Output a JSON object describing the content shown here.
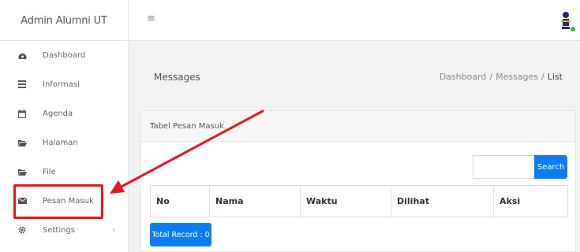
{
  "topbar": {
    "brand": "Admin Alumni UT",
    "menu_toggle": "≡",
    "avatar_icon": "user-avatar-icon"
  },
  "sidebar": {
    "items": [
      {
        "label": "Dashboard",
        "icon": "dashboard-icon"
      },
      {
        "label": "Informasi",
        "icon": "list-icon"
      },
      {
        "label": "Agenda",
        "icon": "calendar-icon"
      },
      {
        "label": "Halaman",
        "icon": "folder-icon"
      },
      {
        "label": "File",
        "icon": "folder-icon"
      },
      {
        "label": "Pesan Masuk",
        "icon": "envelope-icon"
      },
      {
        "label": "Settings",
        "icon": "gear-icon",
        "chevron": "›"
      }
    ]
  },
  "content": {
    "title": "Messages",
    "breadcrumb": [
      "Dashboard",
      "Messages",
      "List"
    ],
    "breadcrumb_sep": "/"
  },
  "card": {
    "title": "Tabel Pesan Masuk",
    "search_placeholder": "",
    "search_label": "Search",
    "columns": [
      "No",
      "Nama",
      "Waktu",
      "Dilihat",
      "Aksi"
    ],
    "total_label": "Total Record : 0"
  },
  "colors": {
    "accent": "#0d7cf2",
    "annotation": "#e8161d"
  }
}
